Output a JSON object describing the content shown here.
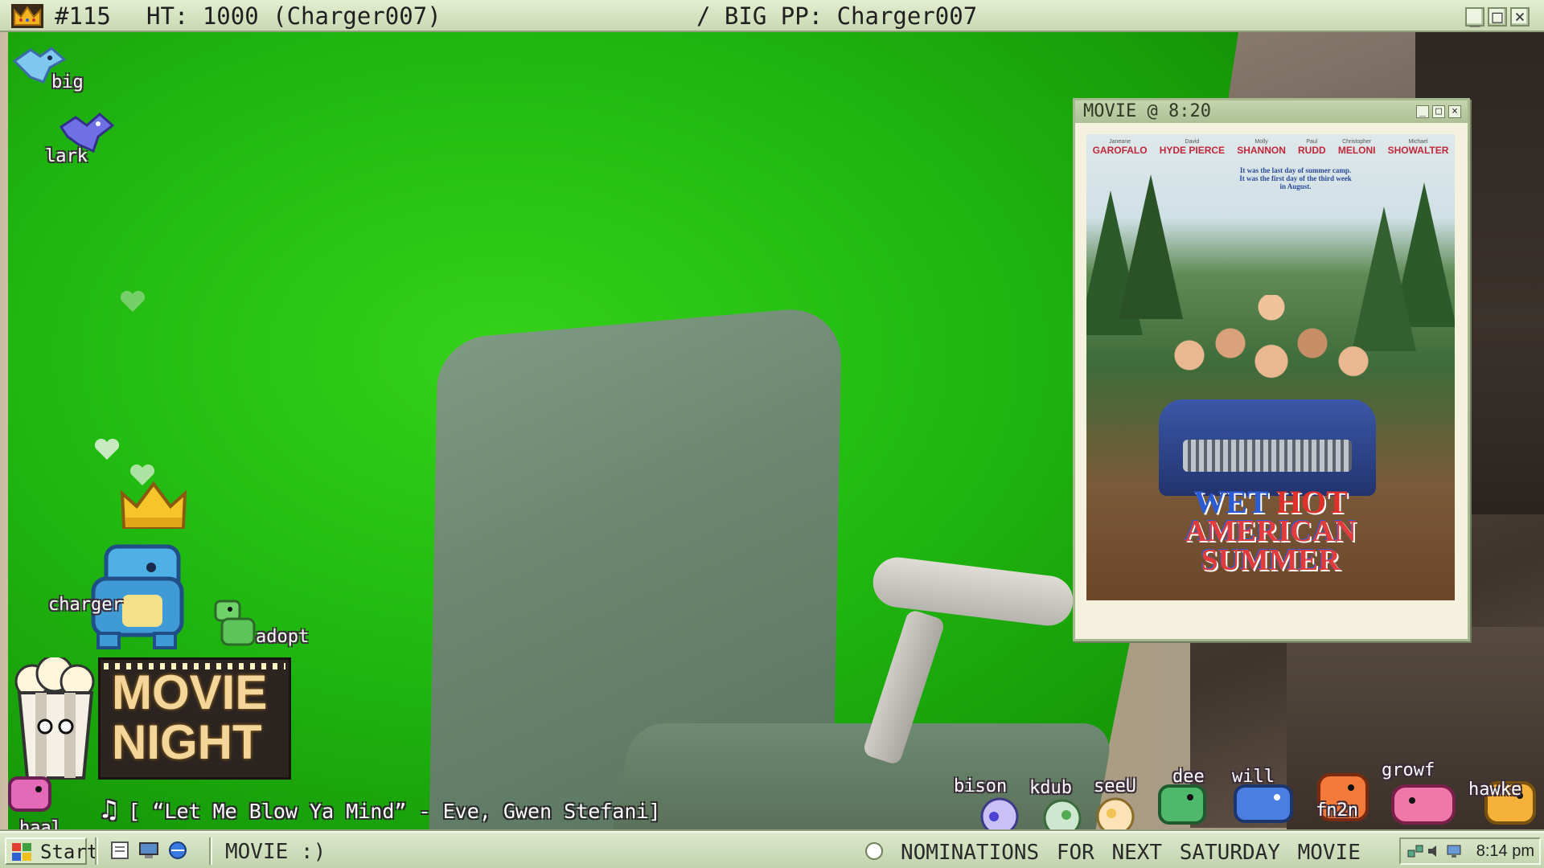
{
  "header": {
    "rank": "#115",
    "ht": "HT: 1000 (Charger007)",
    "bigpp": "/ BIG PP: Charger007",
    "crown_icon": "crown-icon"
  },
  "movie_window": {
    "title": "MOVIE @ 8:20",
    "poster": {
      "credits": [
        {
          "first": "Janeane",
          "last": "GAROFALO"
        },
        {
          "first": "David",
          "last": "HYDE PIERCE"
        },
        {
          "first": "Molly",
          "last": "SHANNON"
        },
        {
          "first": "Paul",
          "last": "RUDD"
        },
        {
          "first": "Christopher",
          "last": "MELONI"
        },
        {
          "first": "Michael",
          "last": "SHOWALTER"
        }
      ],
      "tagline": "It was the last day of summer camp. It was the first day of the third week in August.",
      "title_line1_a": "WET ",
      "title_line1_b": "HOT",
      "title_line2": "AMERICAN",
      "title_line3": "SUMMER"
    }
  },
  "pets": {
    "big": "big",
    "lark": "lark",
    "charger": "charger",
    "adopt": "adopt",
    "haal": "haal"
  },
  "movie_night": {
    "line1": "MOVIE",
    "line2": "NIGHT"
  },
  "now_playing": {
    "icon": "♫",
    "text": "[ “Let Me Blow Ya Mind” - Eve, Gwen Stefani]"
  },
  "bottom_pets": [
    "bison",
    "kdub",
    "seeU",
    "dee",
    "will",
    "fn2n",
    "growf",
    "hawke"
  ],
  "taskbar": {
    "start": "Start",
    "task": "MOVIE :)",
    "ticker": "NOMINATIONS FOR NEXT SATURDAY MOVIE",
    "clock": "8:14 pm"
  },
  "colors": {
    "greenscreen": "#20b810",
    "taskbar": "#c2d3ae",
    "window_frame": "#a7b78f",
    "poster_title_blue": "#2c5bd6",
    "poster_title_red": "#e23b3b"
  }
}
